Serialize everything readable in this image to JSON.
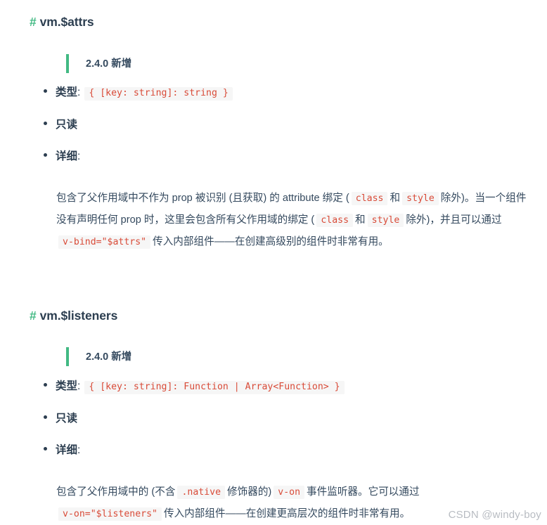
{
  "document": {
    "watermark": "CSDN @windy-boy",
    "accent_green": "#42b983",
    "code_text_color": "#d94b38",
    "code_bg_color": "#f6f6f6",
    "body_text_color": "#34495e"
  },
  "sections": [
    {
      "hash": "#",
      "title": "vm.$attrs",
      "since": "2.4.0 新增",
      "bullets": [
        {
          "label": "类型",
          "colon": ":",
          "code": "{ [key: string]: string }"
        },
        {
          "label": "只读",
          "colon": "",
          "code": ""
        },
        {
          "label": "详细",
          "colon": ":",
          "code": ""
        }
      ],
      "detail": {
        "parts": [
          {
            "t": "text",
            "v": "包含了父作用域中不作为 prop 被识别 (且获取) 的 attribute 绑定 ("
          },
          {
            "t": "code",
            "v": "class"
          },
          {
            "t": "text",
            "v": "和"
          },
          {
            "t": "code",
            "v": "style"
          },
          {
            "t": "text",
            "v": "除外)。当一个组件没有声明任何 prop 时，这里会包含所有父作用域的绑定 ("
          },
          {
            "t": "code",
            "v": "class"
          },
          {
            "t": "text",
            "v": "和"
          },
          {
            "t": "code",
            "v": "style"
          },
          {
            "t": "text",
            "v": "除外)，并且可以通过"
          },
          {
            "t": "code",
            "v": "v-bind=\"$attrs\""
          },
          {
            "t": "text",
            "v": "传入内部组件——在创建高级别的组件时非常有用。"
          }
        ]
      }
    },
    {
      "hash": "#",
      "title": "vm.$listeners",
      "since": "2.4.0 新增",
      "bullets": [
        {
          "label": "类型",
          "colon": ":",
          "code": "{ [key: string]: Function | Array<Function> }"
        },
        {
          "label": "只读",
          "colon": "",
          "code": ""
        },
        {
          "label": "详细",
          "colon": ":",
          "code": ""
        }
      ],
      "detail": {
        "parts": [
          {
            "t": "text",
            "v": "包含了父作用域中的 (不含"
          },
          {
            "t": "code",
            "v": ".native"
          },
          {
            "t": "text",
            "v": "修饰器的)"
          },
          {
            "t": "code",
            "v": "v-on"
          },
          {
            "t": "text",
            "v": "事件监听器。它可以通过"
          },
          {
            "t": "code",
            "v": "v-on=\"$listeners\""
          },
          {
            "t": "text",
            "v": "传入内部组件——在创建更高层次的组件时非常有用。"
          }
        ]
      }
    }
  ]
}
